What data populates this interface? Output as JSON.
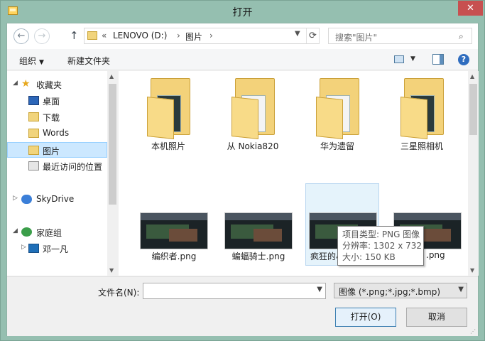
{
  "title": "打开",
  "close_glyph": "✕",
  "nav": {
    "path": [
      "LENOVO (D:)",
      "图片"
    ],
    "path_sep": "›",
    "prefix": "«",
    "search_placeholder": "搜索\"图片\""
  },
  "toolbar": {
    "organize": "组织",
    "new_folder": "新建文件夹"
  },
  "sidebar": {
    "favorites": "收藏夹",
    "items": [
      "桌面",
      "下载",
      "Words",
      "图片",
      "最近访问的位置"
    ],
    "skydrive": "SkyDrive",
    "homegroup": "家庭组",
    "homegroup_user": "邓一凡"
  },
  "folders": [
    {
      "label": "本机照片"
    },
    {
      "label": "从 Nokia820"
    },
    {
      "label": "华为遗留"
    },
    {
      "label": "三星照相机"
    }
  ],
  "images": [
    {
      "label": "编织者.png"
    },
    {
      "label": "蝙蝠骑士.png"
    },
    {
      "label": "疯狂的小"
    },
    {
      "label": ".png"
    }
  ],
  "tooltip": {
    "type": "项目类型: PNG 图像",
    "resolution": "分辨率: 1302 x 732",
    "size": "大小: 150 KB"
  },
  "bottom": {
    "filename_label": "文件名(N):",
    "filename_value": "",
    "filter": "图像 (*.png;*.jpg;*.bmp)",
    "open_button": "打开(O)",
    "cancel_button": "取消"
  }
}
